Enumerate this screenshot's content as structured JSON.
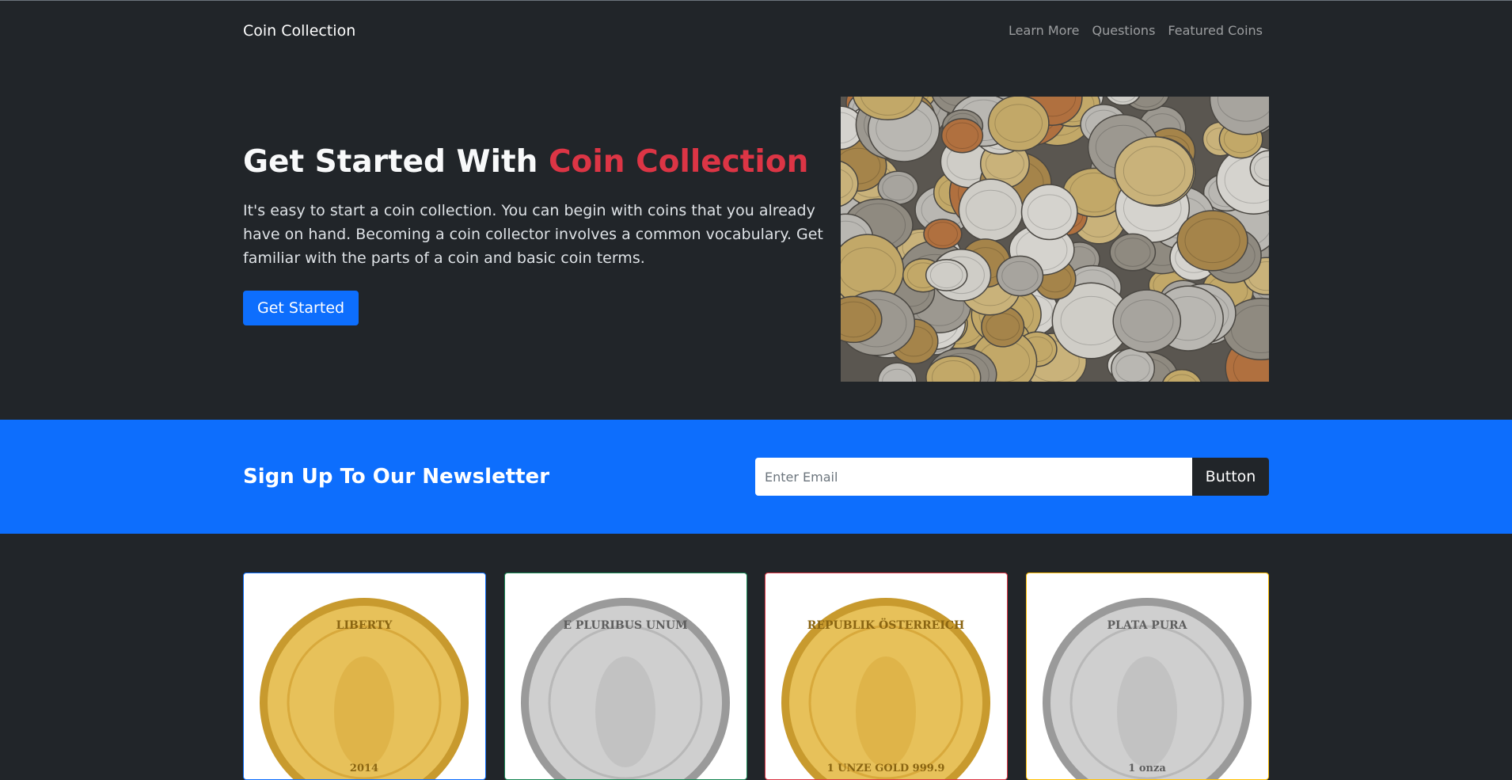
{
  "nav": {
    "brand": "Coin Collection",
    "links": [
      "Learn More",
      "Questions",
      "Featured Coins"
    ]
  },
  "hero": {
    "title_plain": "Get Started With ",
    "title_accent": "Coin Collection",
    "description": "It's easy to start a coin collection. You can begin with coins that you already have on hand. Becoming a coin collector involves a common vocabulary. Get familiar with the parts of a coin and basic coin terms.",
    "button": "Get Started",
    "accent_color": "#dc3545"
  },
  "newsletter": {
    "title": "Sign Up To Our Newsletter",
    "placeholder": "Enter Email",
    "button": "Button"
  },
  "cards": [
    {
      "coin_text_top": "LIBERTY",
      "coin_text_bottom": "2014",
      "border": "#0d6efd",
      "tone": "gold"
    },
    {
      "coin_text_top": "E PLURIBUS UNUM",
      "coin_text_bottom": "",
      "border": "#198754",
      "tone": "silver"
    },
    {
      "coin_text_top": "REPUBLIK ÖSTERREICH",
      "coin_text_bottom": "1 UNZE GOLD 999.9",
      "border": "#dc3545",
      "tone": "gold"
    },
    {
      "coin_text_top": "PLATA PURA",
      "coin_text_bottom": "1 onza",
      "border": "#ffc107",
      "tone": "silver"
    }
  ],
  "colors": {
    "background": "#212529",
    "primary": "#0d6efd"
  }
}
